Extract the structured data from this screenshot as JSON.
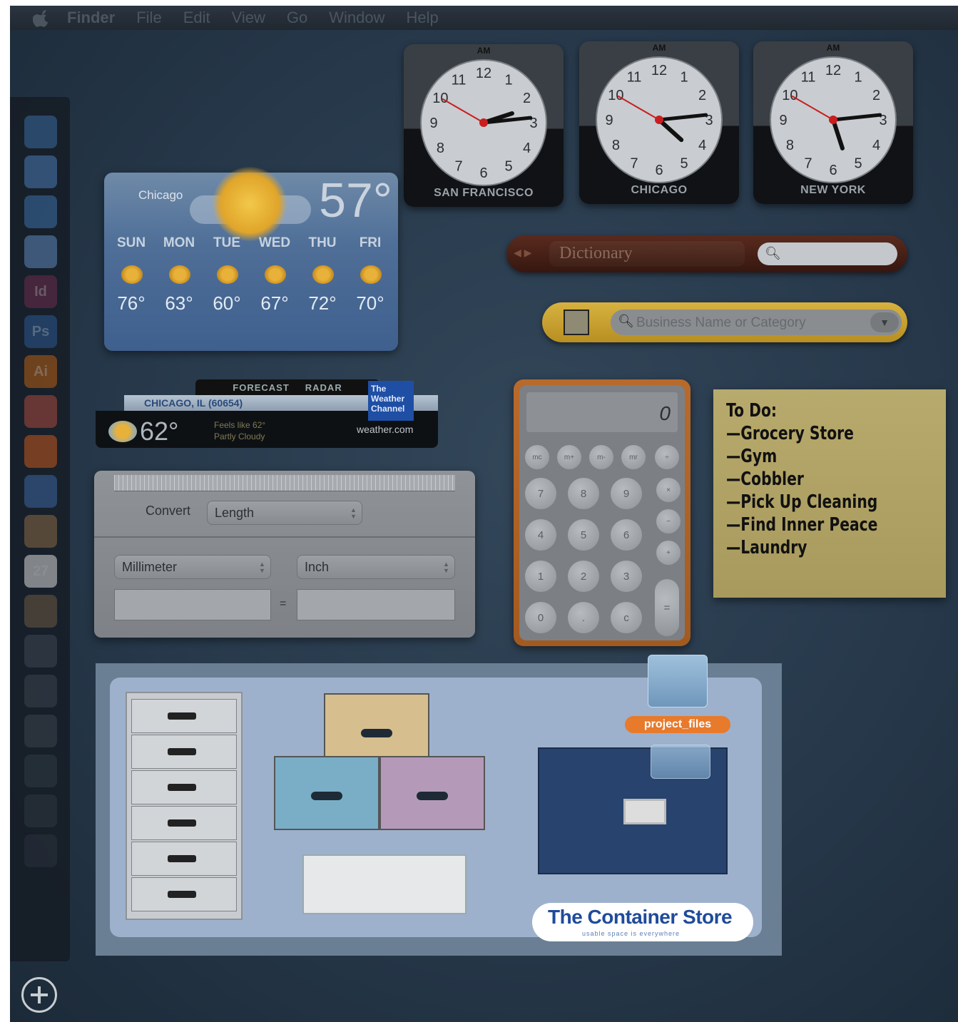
{
  "menubar": {
    "items": [
      "Finder",
      "File",
      "Edit",
      "View",
      "Go",
      "Window",
      "Help"
    ]
  },
  "dock": {
    "icons": [
      "",
      "",
      "",
      "",
      "Id",
      "Ps",
      "Ai",
      "",
      "",
      "",
      "",
      "27",
      "",
      "",
      "",
      "",
      "",
      "",
      ""
    ],
    "add_widget_icon": "plus-circle-icon"
  },
  "clocks": [
    {
      "city": "SAN FRANCISCO",
      "ampm": "AM",
      "hour": 2.4,
      "minute": 14,
      "second": 50
    },
    {
      "city": "CHICAGO",
      "ampm": "AM",
      "hour": 4.4,
      "minute": 14,
      "second": 50
    },
    {
      "city": "NEW YORK",
      "ampm": "AM",
      "hour": 5.4,
      "minute": 14,
      "second": 50
    }
  ],
  "weather": {
    "city": "Chicago",
    "current_temp": "57°",
    "forecast": [
      {
        "day": "SUN",
        "hi": "76°"
      },
      {
        "day": "MON",
        "hi": "63°"
      },
      {
        "day": "TUE",
        "hi": "60°"
      },
      {
        "day": "WED",
        "hi": "67°"
      },
      {
        "day": "THU",
        "hi": "72°"
      },
      {
        "day": "FRI",
        "hi": "70°"
      }
    ]
  },
  "weather_channel": {
    "tabs": [
      "FORECAST",
      "RADAR"
    ],
    "location": "CHICAGO, IL (60654)",
    "temp": "62°",
    "feels": "Feels like 62°",
    "condition": "Partly Cloudy",
    "logo": "The Weather Channel",
    "url": "weather.com"
  },
  "converter": {
    "convert_label": "Convert",
    "category": "Length",
    "from_unit": "Millimeter",
    "to_unit": "Inch",
    "from_value": "",
    "to_value": "",
    "equals": "="
  },
  "dictionary": {
    "source": "Dictionary",
    "search_value": ""
  },
  "yellow_pages": {
    "placeholder": "Business Name or Category"
  },
  "calculator": {
    "display": "0",
    "memory_keys": [
      "mc",
      "m+",
      "m-",
      "mr"
    ],
    "op_keys": [
      "÷",
      "×",
      "−",
      "+"
    ],
    "rows": [
      [
        "7",
        "8",
        "9"
      ],
      [
        "4",
        "5",
        "6"
      ],
      [
        "1",
        "2",
        "3"
      ],
      [
        "0",
        ".",
        "c"
      ]
    ],
    "equals": "="
  },
  "sticky": {
    "lines": [
      "To Do:",
      "—Grocery Store",
      "—Gym",
      "—Cobbler",
      "—Pick Up Cleaning",
      "—Find Inner Peace",
      "—Laundry"
    ]
  },
  "container_store": {
    "name": "The Container Store",
    "tagline": "usable space is everywhere",
    "folder_label": "project_files"
  }
}
